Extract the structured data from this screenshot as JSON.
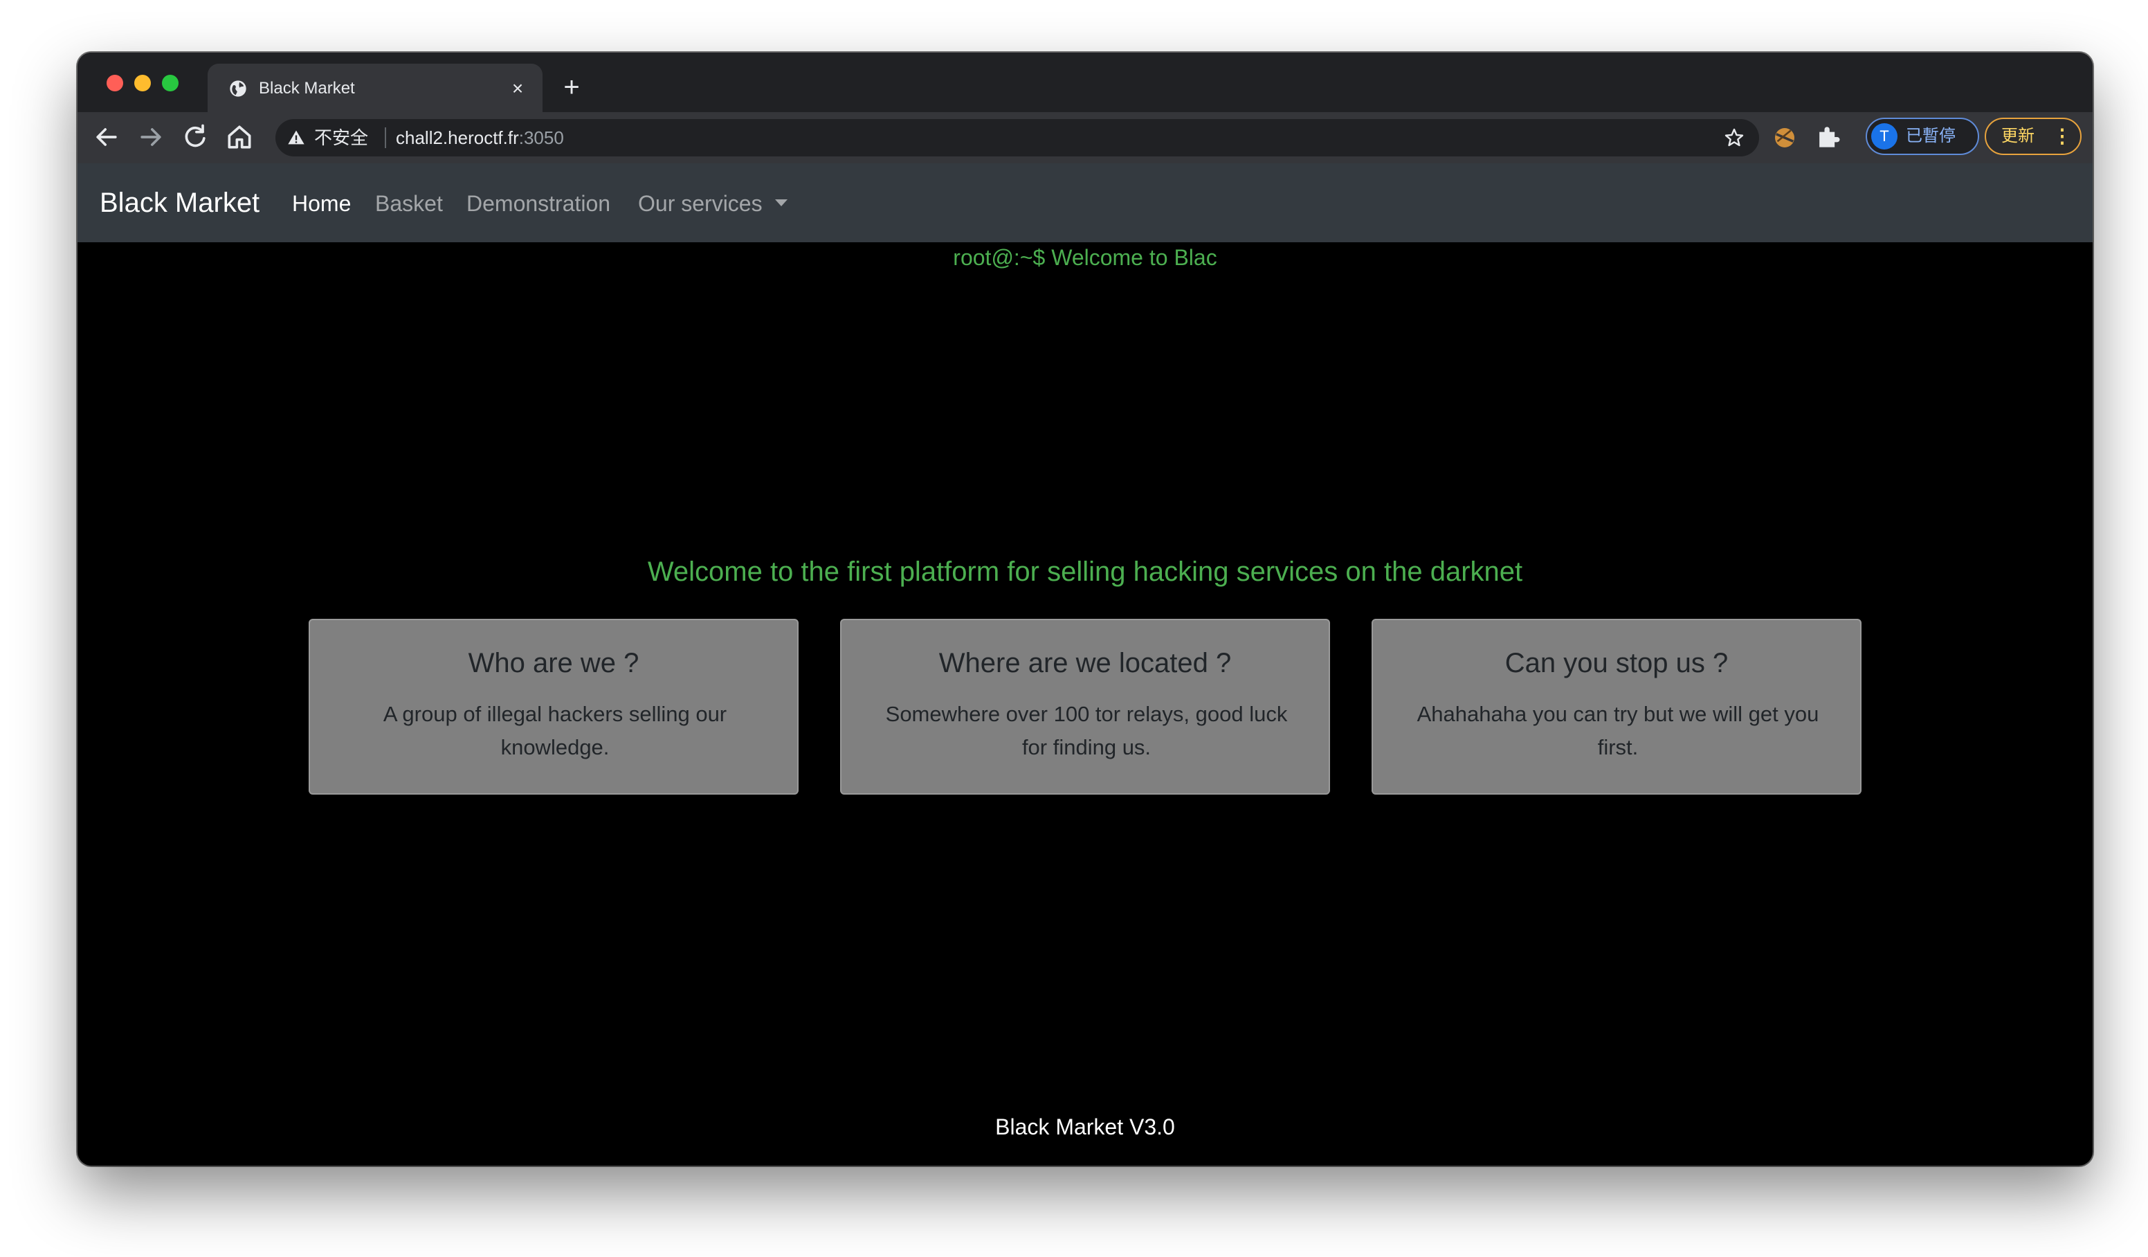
{
  "browser": {
    "tab_title": "Black Market",
    "tab_close": "×",
    "new_tab": "+",
    "insecure_label": "不安全",
    "url_host": "chall2.heroctf.fr",
    "url_port": ":3050",
    "profile_initial": "T",
    "profile_label": "已暫停",
    "update_label": "更新",
    "update_menu": "⋮"
  },
  "navbar": {
    "brand": "Black Market",
    "links": [
      "Home",
      "Basket",
      "Demonstration",
      "Our services"
    ],
    "active": "Home"
  },
  "main": {
    "terminal_line": "root@:~$ Welcome to Blac",
    "tagline": "Welcome to the first platform for selling hacking services on the darknet",
    "cards": [
      {
        "title": "Who are we ?",
        "text": "A group of illegal hackers selling our knowledge."
      },
      {
        "title": "Where are we located ?",
        "text": "Somewhere over 100 tor relays, good luck for finding us."
      },
      {
        "title": "Can you stop us ?",
        "text": "Ahahahaha you can try but we will get you first."
      }
    ]
  },
  "footer": {
    "text": "Black Market V3.0"
  },
  "colors": {
    "terminal_green": "#4caf50",
    "navbar_bg": "#343a40",
    "card_bg": "#808080",
    "page_bg": "#000000"
  },
  "icons": [
    "globe-favicon-icon",
    "back-arrow-icon",
    "forward-arrow-icon",
    "reload-icon",
    "home-icon",
    "warning-icon",
    "star-icon",
    "extension-ball-icon",
    "puzzle-icon",
    "chevron-down-icon"
  ]
}
